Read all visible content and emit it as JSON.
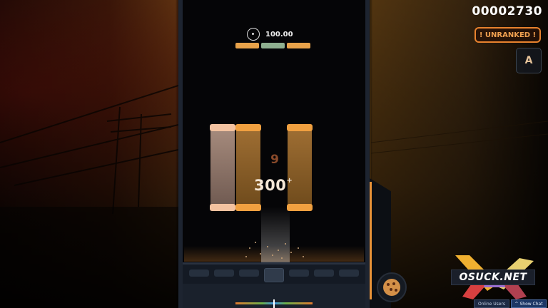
{
  "hud": {
    "accuracy": "100.00",
    "hp_segments": [
      "#e8a24a",
      "#8fb090",
      "#e8a24a"
    ],
    "score_main": "00002730",
    "ranking_status": "! UNRANKED !",
    "mod_letter": "A",
    "combo": "9",
    "judgement": "300",
    "judgement_suffix": "+"
  },
  "watermark": {
    "text": "OSUCK.NET"
  },
  "buttons": {
    "online_users": "Online Users",
    "show_chat": "Show Chat"
  },
  "colors": {
    "accent_orange": "#e8822e",
    "note_orange": "#f0a040",
    "note_peach": "#f3c2a0"
  }
}
